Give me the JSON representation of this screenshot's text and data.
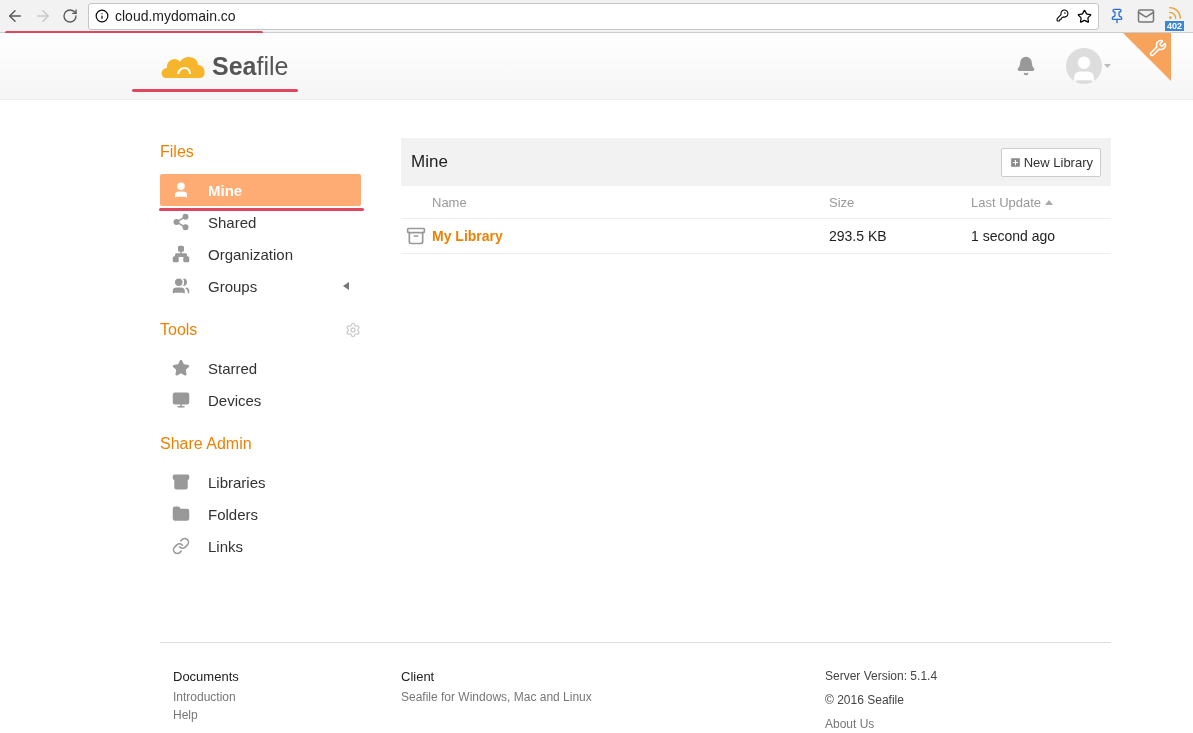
{
  "browser": {
    "url": "cloud.mydomain.co",
    "extension_badge": "402"
  },
  "header": {
    "logo": "**Sea**file"
  },
  "sidebar": {
    "sections": [
      {
        "title": "Files",
        "items": [
          {
            "label": "Mine",
            "selected": true
          },
          {
            "label": "Shared",
            "selected": false
          },
          {
            "label": "Organization",
            "selected": false
          },
          {
            "label": "Groups",
            "selected": false,
            "expanded": false
          }
        ]
      },
      {
        "title": "Tools",
        "items": [
          {
            "label": "Starred",
            "selected": false
          },
          {
            "label": "Devices",
            "selected": false
          }
        ]
      },
      {
        "title": "Share Admin",
        "items": [
          {
            "label": "Libraries",
            "selected": false
          },
          {
            "label": "Folders",
            "selected": false
          },
          {
            "label": "Links",
            "selected": false
          }
        ]
      }
    ]
  },
  "main": {
    "title": "Mine",
    "new_button": "New Library",
    "columns": [
      {
        "label": "Name",
        "sorted": false
      },
      {
        "label": "Size",
        "sorted": false
      },
      {
        "label": "Last Update",
        "sorted": true
      }
    ],
    "rows": [
      {
        "name": "My Library",
        "size": "293.5 KB",
        "updated": "1 second ago"
      }
    ]
  },
  "footer": {
    "columns": [
      {
        "title": "Documents",
        "links": [
          "Introduction",
          "Help"
        ]
      },
      {
        "title": "Client",
        "links": [
          "Seafile for Windows, Mac and Linux"
        ]
      },
      {
        "lines": [
          "Server Version: 5.1.4",
          "© 2016 Seafile"
        ],
        "links": [
          "About Us"
        ]
      }
    ]
  }
}
